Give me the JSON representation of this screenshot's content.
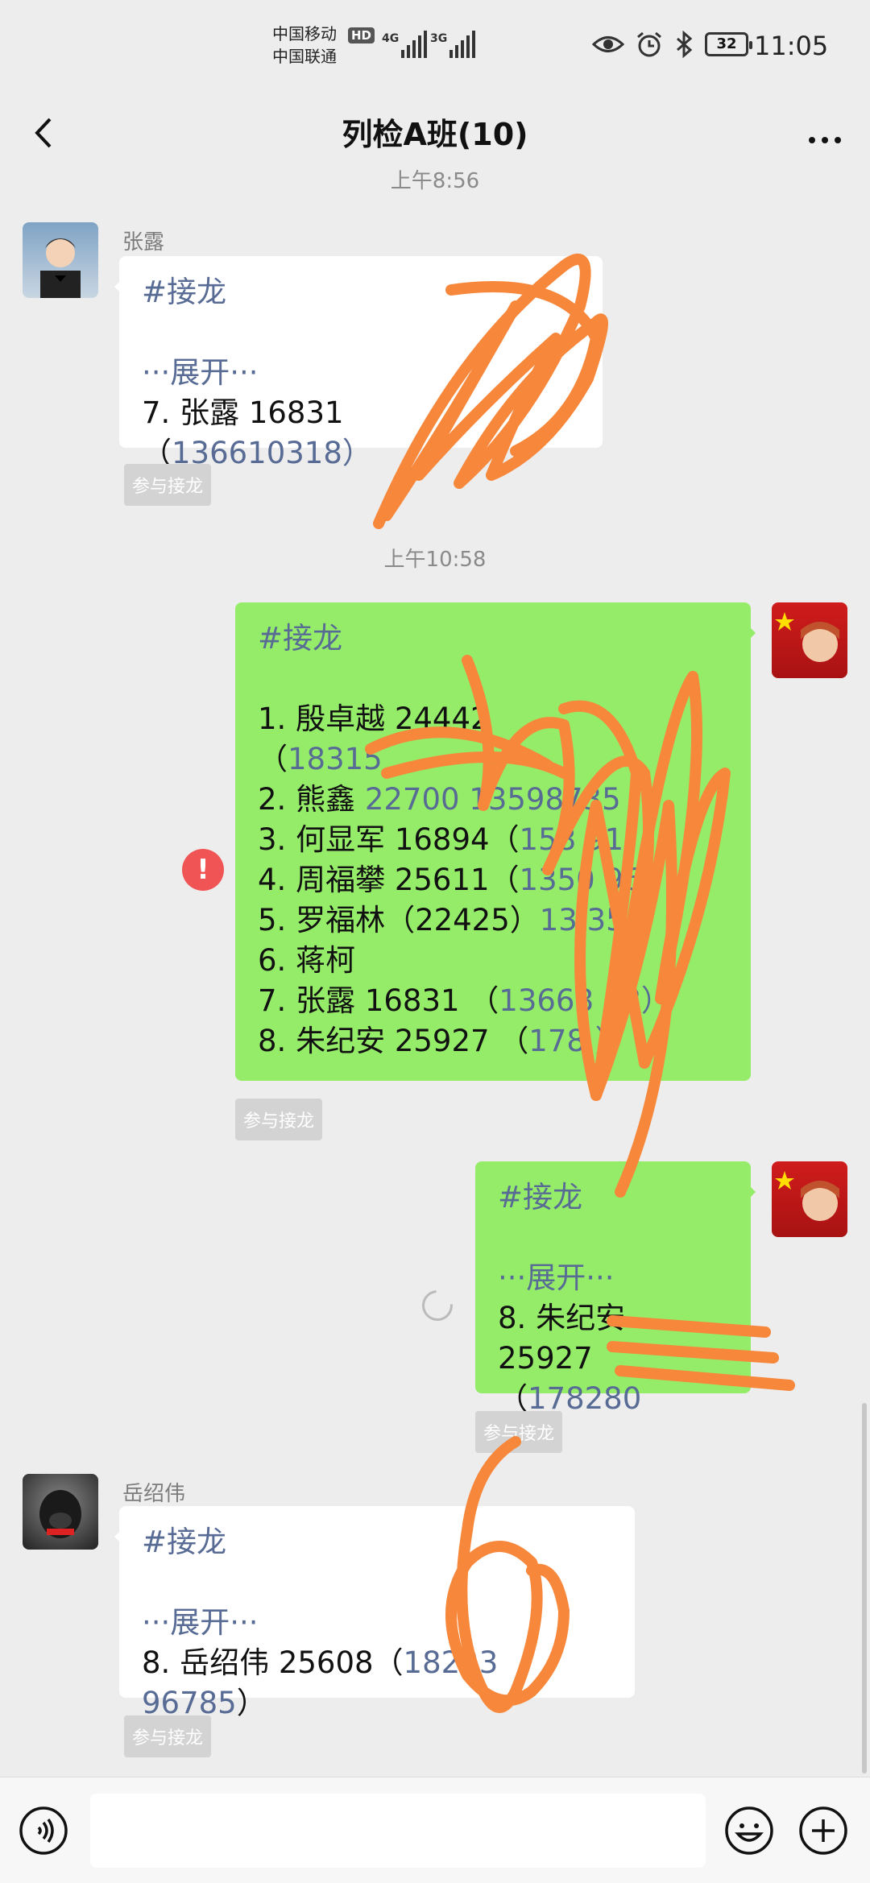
{
  "status_bar": {
    "carrier1": "中国移动",
    "carrier2": "中国联通",
    "hd": "HD",
    "net1": "4G",
    "net2": "3G",
    "battery": "32",
    "time": "11:05"
  },
  "header": {
    "title": "列检A班(10)"
  },
  "messages": [
    {
      "time": "上午8:56",
      "sender": "张露",
      "tag": "#接龙",
      "expand": "···展开···",
      "line_prefix": "7. 张露 16831 （",
      "line_link": "1366",
      "line_tail": "10318）",
      "join": "参与接龙"
    },
    {
      "time": "上午10:58",
      "tag": "#接龙",
      "lines": [
        {
          "text": "1. 殷卓越 24442",
          "link": ""
        },
        {
          "text": "（",
          "link": "18315"
        },
        {
          "text": "2. 熊鑫 ",
          "link": "22700 13598735"
        },
        {
          "text": "3. 何显军 16894（",
          "link": "158        91"
        },
        {
          "text": "4. 周福攀 25611（",
          "link": "1350      96）"
        },
        {
          "text": "5. 罗福林（22425）",
          "link": "13         35"
        },
        {
          "text": "6. 蒋柯",
          "link": ""
        },
        {
          "text": "7. 张露 16831 （",
          "link": "13668      18）"
        },
        {
          "text": "8. 朱纪安 25927 （",
          "link": "178          ）"
        }
      ],
      "join": "参与接龙",
      "error": "!"
    },
    {
      "tag": "#接龙",
      "expand": "···展开···",
      "line1": "8. 朱纪安 25927",
      "line2_prefix": "（",
      "line2_link": "178280",
      "join": "参与接龙"
    },
    {
      "sender": "岳绍伟",
      "tag": "#接龙",
      "expand": "···展开···",
      "line_prefix": "8. 岳绍伟  25608（",
      "line_link": "18223 96785",
      "line_tail": "）",
      "join": "参与接龙"
    }
  ],
  "input_bar": {
    "voice_icon": "voice-icon",
    "emoji_icon": "emoji-icon",
    "plus_icon": "plus-icon"
  },
  "colors": {
    "green_bubble": "#95ec69",
    "link": "#576b95",
    "scribble": "#f7873a"
  }
}
